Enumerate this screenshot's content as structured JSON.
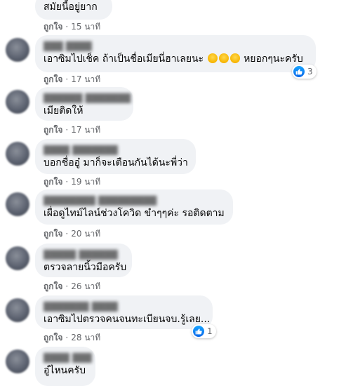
{
  "comments": [
    {
      "text": "สมัยนี้อยู่ยาก",
      "like": "ถูกใจ",
      "time": "15 นาที"
    },
    {
      "text_before": "เอาซิมไปเช็ค ถ้าเป็นชื่อเมียนี่ฮาเลยนะ",
      "emoji_icon": "rolling-on-floor-laughing-emoji",
      "emoji_count": 3,
      "text_after": "หยอกๆนะครับ",
      "like": "ถูกใจ",
      "time": "17 นาที",
      "reaction_count": "3",
      "reaction_icon": "like-icon"
    },
    {
      "text": "เมียติดให้",
      "like": "ถูกใจ",
      "time": "17 นาที"
    },
    {
      "text": "บอกชื่ออู๋ มาก็จะเตือนกันได้นะพี่ว่า",
      "like": "ถูกใจ",
      "time": "19 นาที"
    },
    {
      "text": "เผื่อดูไทม์ไลน์ช่วงโควิด ขำๆๆค่ะ รอติดตาม",
      "like": "ถูกใจ",
      "time": "20 นาที"
    },
    {
      "text": "ตรวจลายนิ้วมือครับ",
      "like": "ถูกใจ",
      "time": "26 นาที"
    },
    {
      "text": "เอาซิมไปตรวจคนจนทะเบียนจบ.รู้เลย...",
      "like": "ถูกใจ",
      "time": "28 นาที",
      "reaction_count": "1",
      "reaction_icon": "like-icon"
    },
    {
      "text": "อู๋ไหนครับ"
    }
  ],
  "separator": "·",
  "colors": {
    "bubble": "#f0f2f5",
    "meta": "#65676b",
    "like_badge": "#1877f2"
  }
}
